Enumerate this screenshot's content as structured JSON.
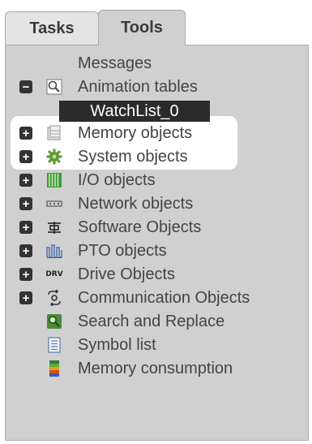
{
  "tabs": {
    "tasks": "Tasks",
    "tools": "Tools"
  },
  "tree": {
    "messages": "Messages",
    "animation_tables": {
      "label": "Animation tables",
      "expander": "−"
    },
    "watchlist": "WatchList_0",
    "items": [
      {
        "label": "Memory objects",
        "expander": "+",
        "icon": "memory-icon"
      },
      {
        "label": "System objects",
        "expander": "+",
        "icon": "gear-icon"
      },
      {
        "label": "I/O objects",
        "expander": "+",
        "icon": "io-icon"
      },
      {
        "label": "Network objects",
        "expander": "+",
        "icon": "network-icon"
      },
      {
        "label": "Software Objects",
        "expander": "+",
        "icon": "software-icon"
      },
      {
        "label": "PTO objects",
        "expander": "+",
        "icon": "pto-icon"
      },
      {
        "label": "Drive Objects",
        "expander": "+",
        "icon": "drive-icon",
        "icon_text": "DRV"
      },
      {
        "label": "Communication Objects",
        "expander": "+",
        "icon": "communication-icon"
      }
    ],
    "tools": [
      {
        "label": "Search and Replace",
        "icon": "search-replace-icon"
      },
      {
        "label": "Symbol list",
        "icon": "symbol-list-icon"
      },
      {
        "label": "Memory consumption",
        "icon": "memory-consumption-icon"
      }
    ]
  },
  "colors": {
    "panel_bg": "#d0d0d0",
    "highlight_bg": "#ffffff",
    "selected_item_bg": "#2b2b2b",
    "text": "#444444",
    "gear_green": "#5a9a2a",
    "io_green": "#3f9a3a"
  }
}
